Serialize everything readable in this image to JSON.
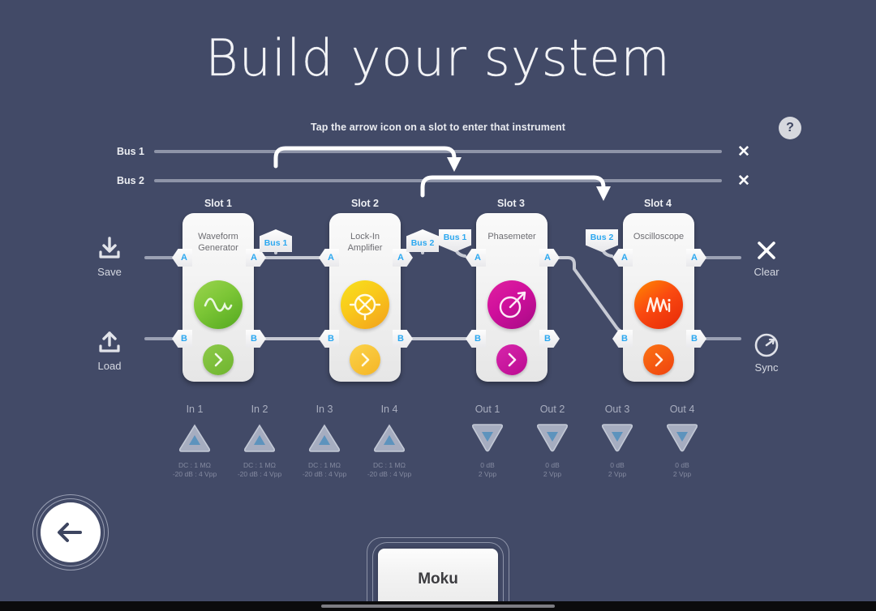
{
  "header": {
    "title": "Build your system",
    "subtitle": "Tap the arrow icon on a slot to enter that instrument",
    "help_icon_label": "?"
  },
  "buses": [
    {
      "label": "Bus 1",
      "clear_label": "✕"
    },
    {
      "label": "Bus 2",
      "clear_label": "✕"
    }
  ],
  "slots": [
    {
      "slot_label": "Slot 1",
      "name": "Waveform\nGenerator",
      "name_line1": "Waveform",
      "name_line2": "Generator",
      "icon": "sine-wave-icon",
      "color": "#63b428",
      "color_light": "#8fd14a",
      "port_in_a": "A",
      "port_in_b": "B",
      "port_out_a": "A",
      "port_out_b": "B",
      "bus_tag": "Bus 1",
      "bus_tag_dir": "up",
      "go_label": "›"
    },
    {
      "slot_label": "Slot 2",
      "name_line1": "Lock-In",
      "name_line2": "Amplifier",
      "icon": "mixer-icon",
      "color": "#f5a623",
      "color_light": "#f7d117",
      "port_in_a": "A",
      "port_in_b": "B",
      "port_out_a": "A",
      "port_out_b": "B",
      "bus_tag": "Bus 2",
      "bus_tag_dir": "up",
      "go_label": "›"
    },
    {
      "slot_label": "Slot 3",
      "name_line1": "Phasemeter",
      "name_line2": "",
      "icon": "phasemeter-icon",
      "color": "#c2009b",
      "color_light": "#e6179f",
      "port_in_a": "A",
      "port_in_b": "B",
      "port_out_a": "A",
      "port_out_b": "B",
      "bus_tag": "Bus 1",
      "bus_tag_dir": "down",
      "go_label": "›"
    },
    {
      "slot_label": "Slot 4",
      "name_line1": "Oscilloscope",
      "name_line2": "",
      "icon": "oscilloscope-icon",
      "color": "#ef3b11",
      "color_light": "#ff8a00",
      "port_in_a": "A",
      "port_in_b": "B",
      "port_out_a": "A",
      "port_out_b": "B",
      "bus_tag": "Bus 2",
      "bus_tag_dir": "down",
      "go_label": "›"
    }
  ],
  "left_controls": [
    {
      "label": "Save",
      "icon": "save-download-icon"
    },
    {
      "label": "Load",
      "icon": "load-upload-icon"
    }
  ],
  "right_controls": [
    {
      "label": "Clear",
      "icon": "clear-x-icon"
    },
    {
      "label": "Sync",
      "icon": "sync-gauge-icon"
    }
  ],
  "inputs": [
    {
      "label": "In 1",
      "meta_line1": "DC : 1 MΩ",
      "meta_line2": "-20 dB : 4 Vpp"
    },
    {
      "label": "In 2",
      "meta_line1": "DC : 1 MΩ",
      "meta_line2": "-20 dB : 4 Vpp"
    },
    {
      "label": "In 3",
      "meta_line1": "DC : 1 MΩ",
      "meta_line2": "-20 dB : 4 Vpp"
    },
    {
      "label": "In 4",
      "meta_line1": "DC : 1 MΩ",
      "meta_line2": "-20 dB : 4 Vpp"
    }
  ],
  "outputs": [
    {
      "label": "Out 1",
      "meta_line1": "0 dB",
      "meta_line2": "2 Vpp"
    },
    {
      "label": "Out 2",
      "meta_line1": "0 dB",
      "meta_line2": "2 Vpp"
    },
    {
      "label": "Out 3",
      "meta_line1": "0 dB",
      "meta_line2": "2 Vpp"
    },
    {
      "label": "Out 4",
      "meta_line1": "0 dB",
      "meta_line2": "2 Vpp"
    }
  ],
  "back_button": {
    "icon": "back-arrow-icon"
  },
  "device": {
    "name": "Moku"
  },
  "colors": {
    "background": "#424a67",
    "accent_blue": "#2ca8f0",
    "bus_line": "#8e94a8",
    "card": "#f2f2f2"
  }
}
